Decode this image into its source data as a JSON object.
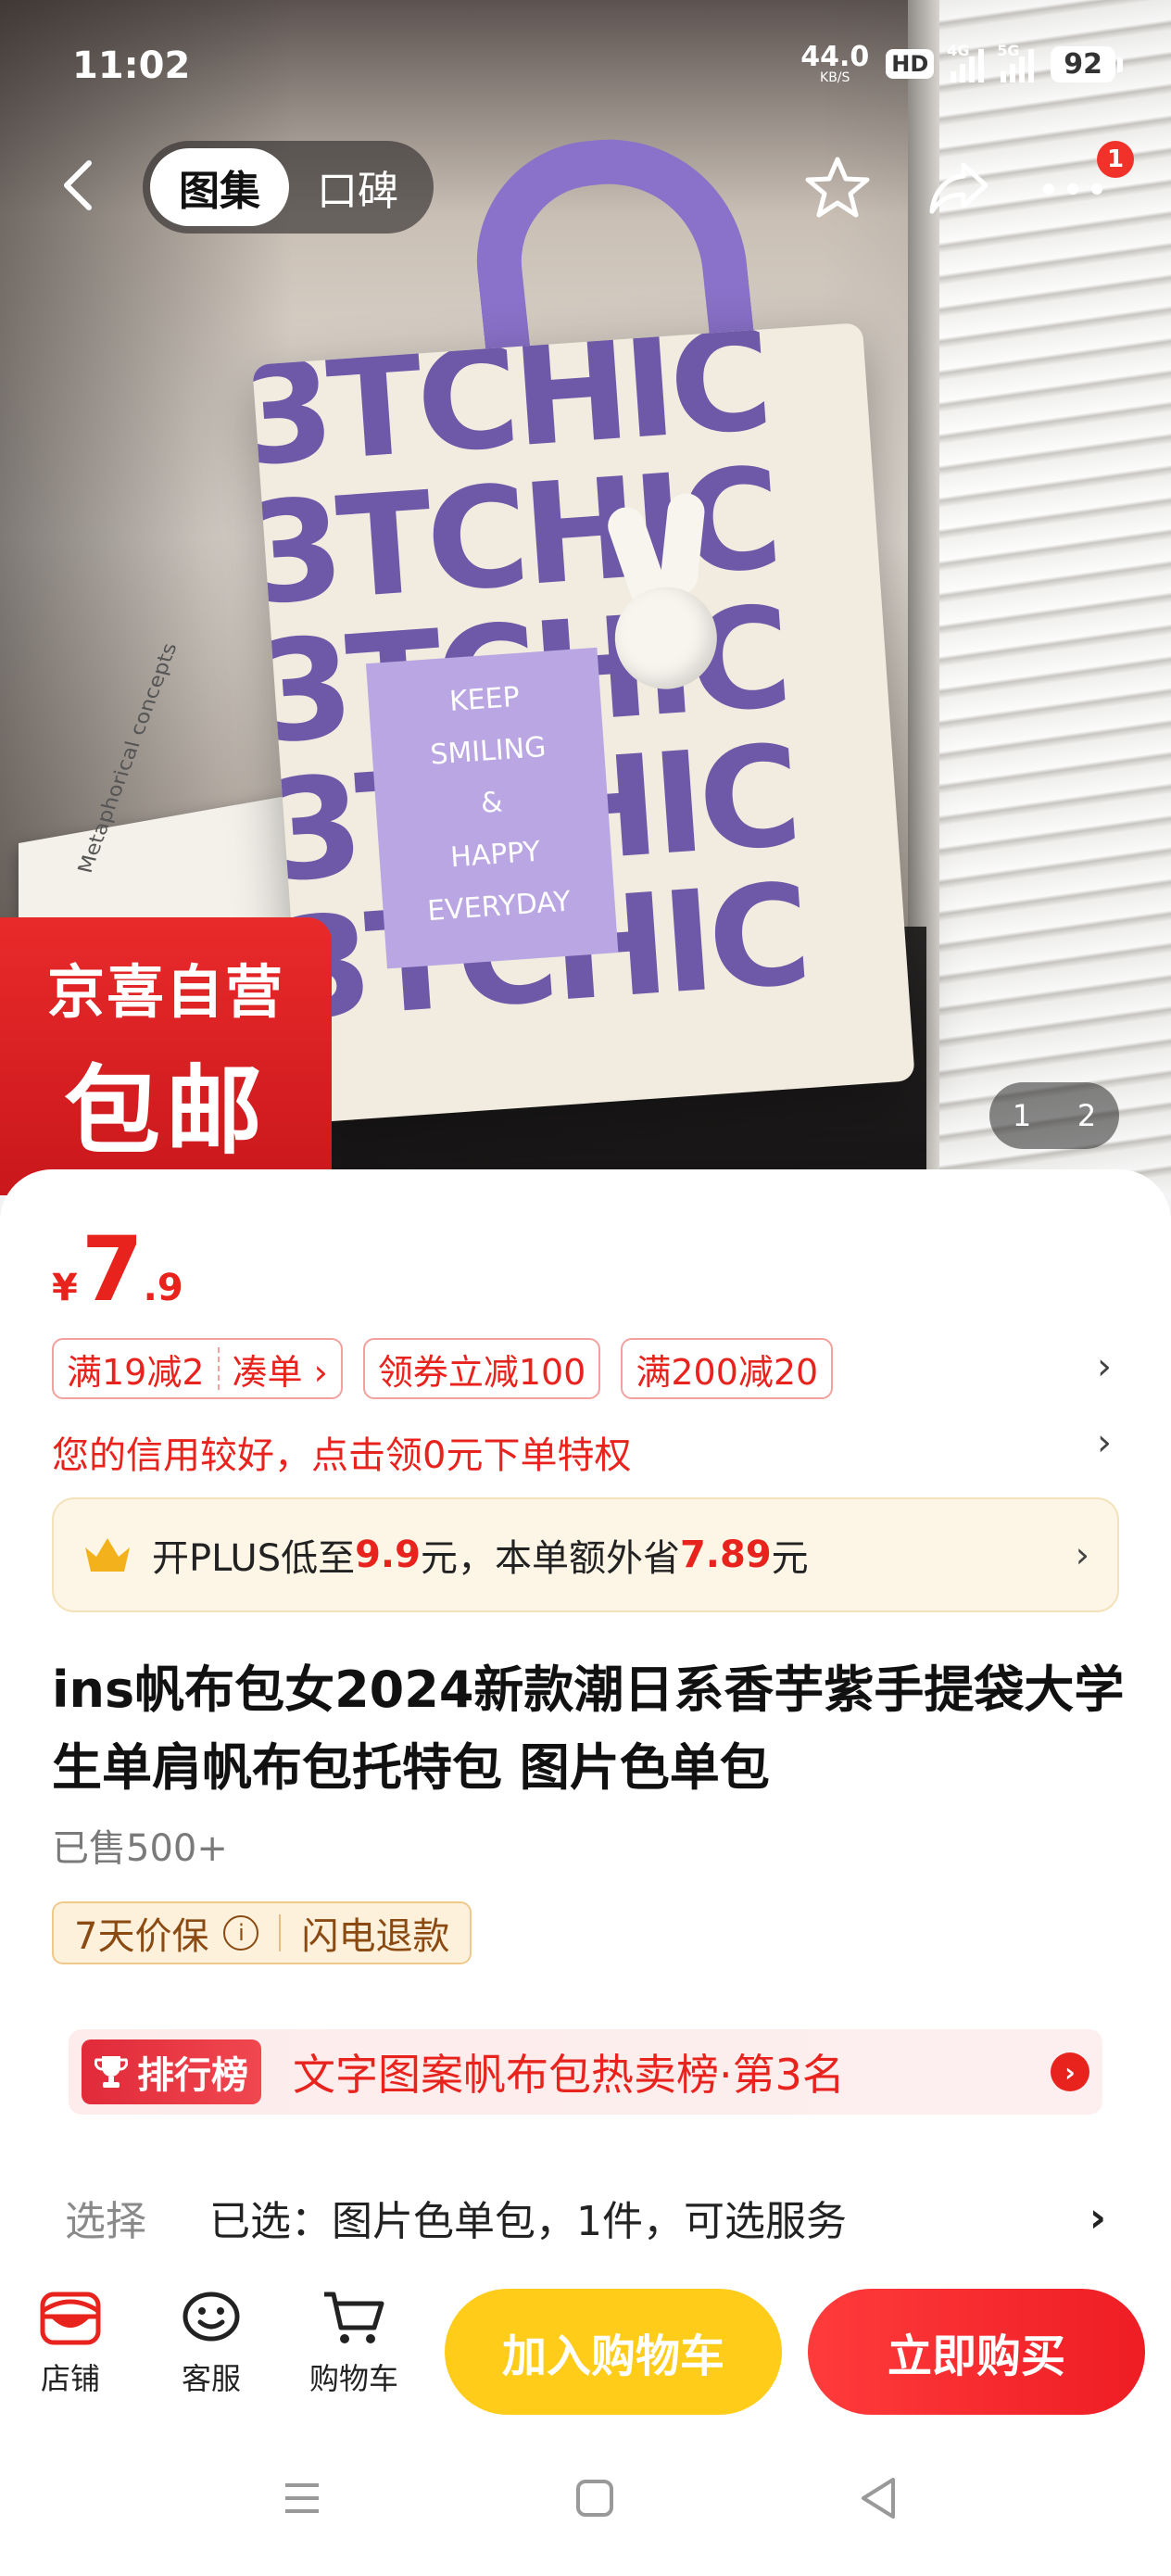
{
  "status_bar": {
    "time": "11:02",
    "net_speed_value": "44.0",
    "net_speed_unit": "KB/S",
    "hd_label": "HD",
    "signal1_label": "4G",
    "signal2_label": "5G",
    "battery": "92"
  },
  "header": {
    "tabs": [
      {
        "label": "图集",
        "active": true
      },
      {
        "label": "口碑",
        "active": false
      }
    ],
    "more_badge": "1"
  },
  "gallery": {
    "bag_print_rows": [
      "3TCHIC",
      "3TCHIC",
      "3TCHIC",
      "3TCHIC",
      "3TCHIC"
    ],
    "bag_patch_lines": [
      "KEEP",
      "SMILING",
      "&",
      "HAPPY",
      "EVERYDAY"
    ],
    "book_text": "Metaphorical concepts",
    "promo_line1": "京喜自营",
    "promo_line2": "包邮",
    "pager_current": "1",
    "pager_total": "2"
  },
  "product": {
    "price_currency": "¥",
    "price_integer": "7",
    "price_decimal": ".9",
    "coupons": [
      {
        "left": "满19减2",
        "right": "凑单 ›"
      },
      {
        "label": "领券立减100"
      },
      {
        "label": "满200减20"
      }
    ],
    "credit_text": "您的信用较好，点击领0元下单特权",
    "plus": {
      "prefix": "开PLUS低至",
      "price1": "9.9",
      "middle": "元，本单额外省",
      "price2": "7.89",
      "suffix": "元"
    },
    "title": "ins帆布包女2024新款潮日系香芋紫手提袋大学生单肩帆布包托特包 图片色单包",
    "sold": "已售500+",
    "guarantee": {
      "item1": "7天价保",
      "item2": "闪电退款"
    },
    "ranking": {
      "tag": "排行榜",
      "text": "文字图案帆布包热卖榜·第3名"
    },
    "selection": {
      "label": "选择",
      "value": "已选：图片色单包，1件，可选服务"
    }
  },
  "action_bar": {
    "shop": "店铺",
    "service": "客服",
    "cart": "购物车",
    "add_to_cart": "加入购物车",
    "buy_now": "立即购买"
  },
  "colors": {
    "accent_red": "#e8231d",
    "cart_yellow": "#ffcc1a",
    "plus_bg": "#fdf6e6"
  }
}
